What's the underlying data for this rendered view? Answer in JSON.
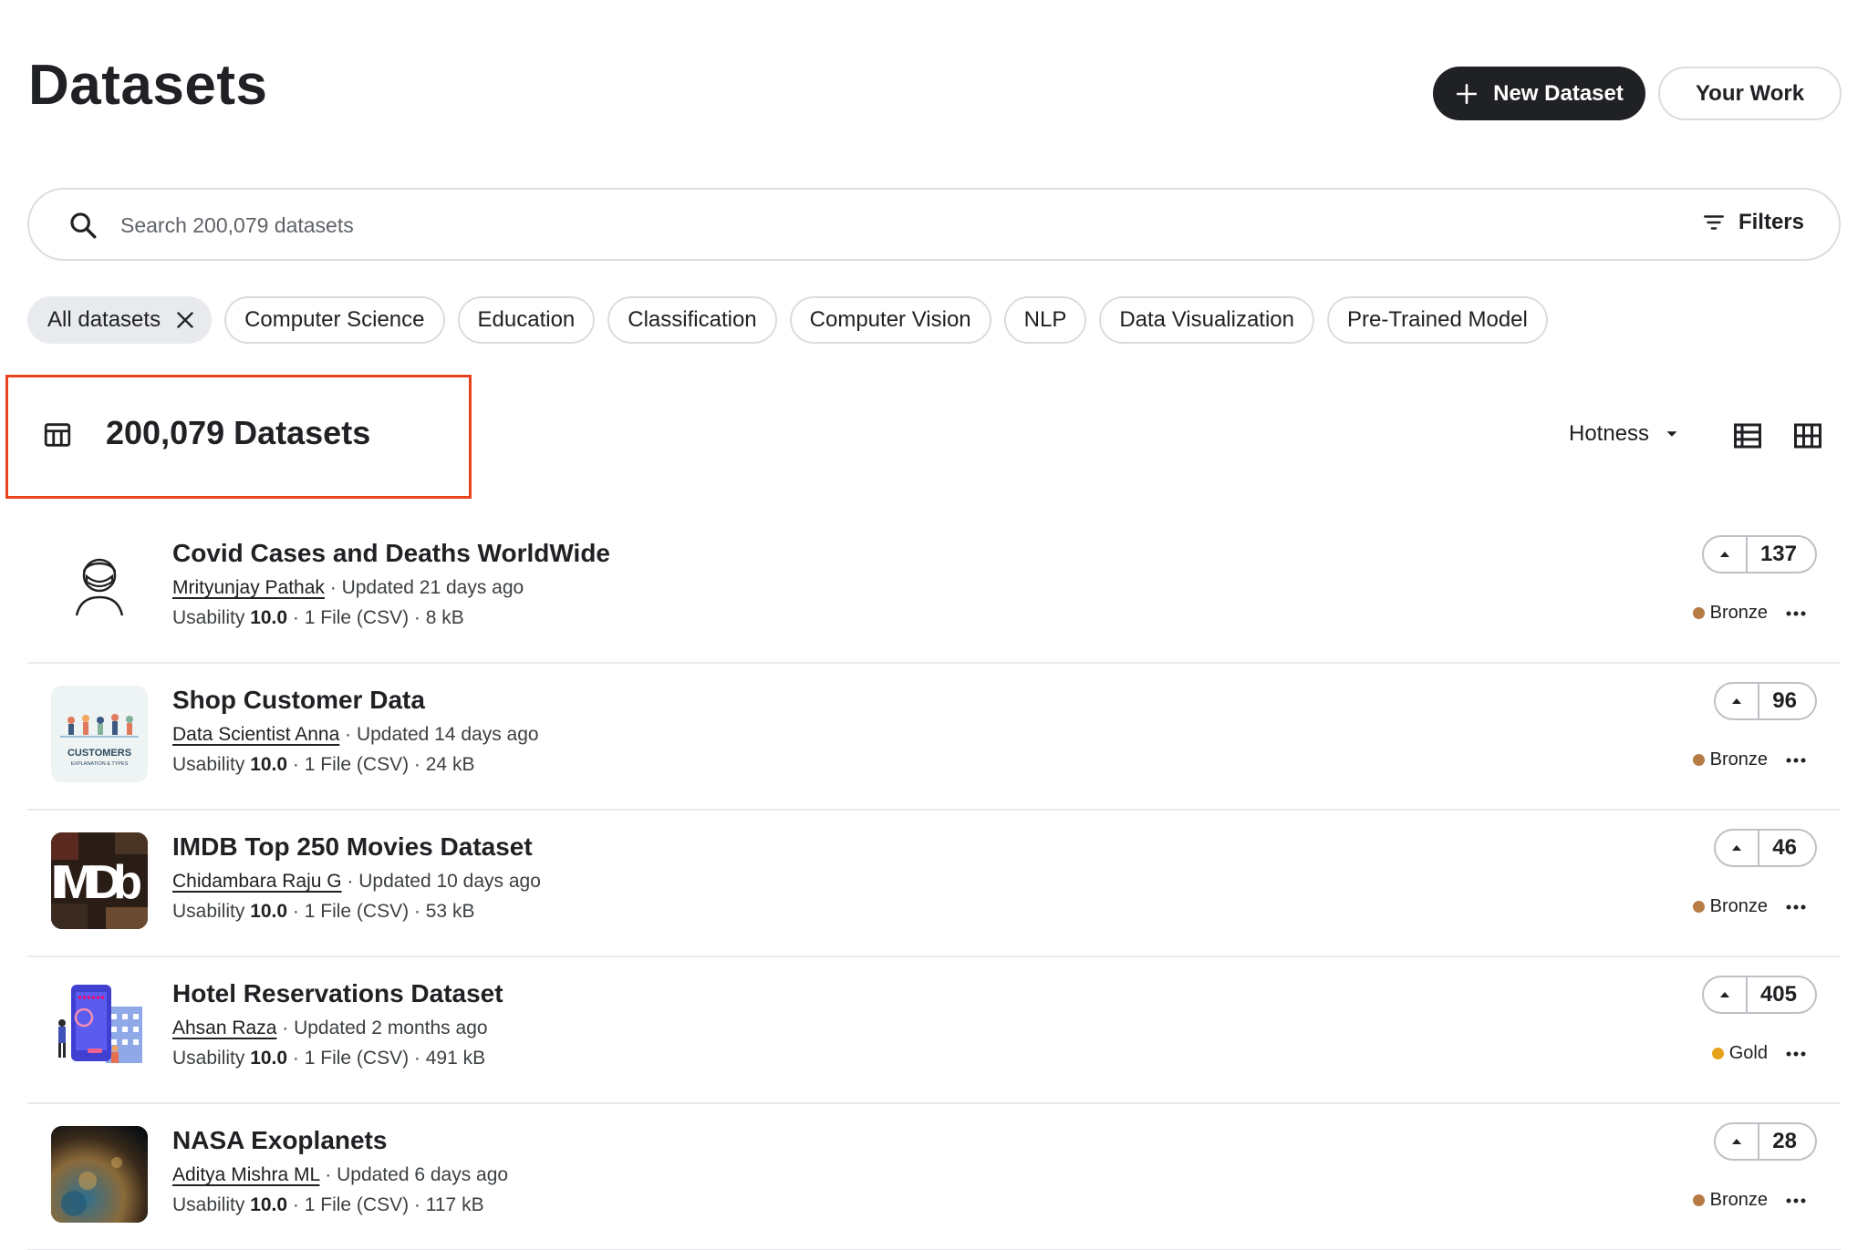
{
  "header": {
    "title": "Datasets",
    "new_dataset_label": "New Dataset",
    "your_work_label": "Your Work"
  },
  "search": {
    "placeholder": "Search 200,079 datasets",
    "filters_label": "Filters"
  },
  "chips": [
    {
      "label": "All datasets",
      "active": true
    },
    {
      "label": "Computer Science"
    },
    {
      "label": "Education"
    },
    {
      "label": "Classification"
    },
    {
      "label": "Computer Vision"
    },
    {
      "label": "NLP"
    },
    {
      "label": "Data Visualization"
    },
    {
      "label": "Pre-Trained Model"
    }
  ],
  "results": {
    "count_label": "200,079 Datasets",
    "sort_label": "Hotness"
  },
  "datasets": [
    {
      "title": "Covid Cases and Deaths WorldWide",
      "author": "Mrityunjay Pathak",
      "updated": " · Updated 21 days ago",
      "usability_label": "Usability ",
      "usability_value": "10.0",
      "files": " · 1 File (CSV) · 8 kB",
      "votes": "137",
      "medal": "Bronze",
      "medal_color": "#b77b46",
      "thumb_icon": "masked-person-icon"
    },
    {
      "title": "Shop Customer Data",
      "author": "Data Scientist Anna",
      "updated": " · Updated 14 days ago",
      "usability_label": "Usability ",
      "usability_value": "10.0",
      "files": " · 1 File (CSV) · 24 kB",
      "votes": "96",
      "medal": "Bronze",
      "medal_color": "#b77b46",
      "thumb_text": "CUSTOMERS",
      "thumb_subtext": "EXPLANATION & TYPES"
    },
    {
      "title": "IMDB Top 250 Movies Dataset",
      "author": "Chidambara Raju G",
      "updated": " · Updated 10 days ago",
      "usability_label": "Usability ",
      "usability_value": "10.0",
      "files": " · 1 File (CSV) · 53 kB",
      "votes": "46",
      "medal": "Bronze",
      "medal_color": "#b77b46",
      "thumb_text": "IMDb"
    },
    {
      "title": "Hotel Reservations Dataset",
      "author": "Ahsan Raza",
      "updated": " · Updated 2 months ago",
      "usability_label": "Usability ",
      "usability_value": "10.0",
      "files": " · 1 File (CSV) · 491 kB",
      "votes": "405",
      "medal": "Gold",
      "medal_color": "#e6a21a",
      "thumb_icon": "hotel-booking-illustration"
    },
    {
      "title": "NASA Exoplanets",
      "author": "Aditya Mishra ML",
      "updated": " · Updated 6 days ago",
      "usability_label": "Usability ",
      "usability_value": "10.0",
      "files": " · 1 File (CSV) · 117 kB",
      "votes": "28",
      "medal": "Bronze",
      "medal_color": "#b77b46",
      "thumb_icon": "planet-surface-image"
    }
  ],
  "colors": {
    "primary_dark": "#202124",
    "border": "#dadce0",
    "highlight_box": "#e8431e",
    "bronze": "#b77b46",
    "gold": "#e6a21a"
  }
}
